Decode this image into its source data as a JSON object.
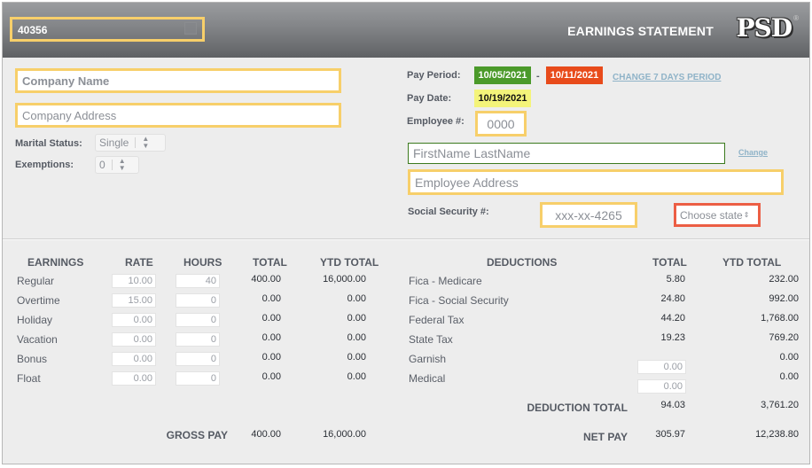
{
  "header": {
    "document_number": "40356",
    "title": "EARNINGS STATEMENT",
    "logo": "PSD",
    "logo_mark": "®"
  },
  "company": {
    "name_placeholder": "Company Name",
    "address_placeholder": "Company Address"
  },
  "employee_settings": {
    "marital_status_label": "Marital Status:",
    "marital_status_value": "Single",
    "exemptions_label": "Exemptions:",
    "exemptions_value": "0",
    "stepper_icon": "updown-arrows-icon"
  },
  "pay_info": {
    "pay_period_label": "Pay Period:",
    "pay_period_start": "10/05/2021",
    "pay_period_separator": "-",
    "pay_period_end": "10/11/2021",
    "change_period_link": "CHANGE 7 DAYS PERIOD",
    "pay_date_label": "Pay Date:",
    "pay_date": "10/19/2021",
    "employee_number_label": "Employee #:",
    "employee_number": "0000"
  },
  "employee": {
    "name_placeholder": "FirstName LastName",
    "change_link": "Change",
    "address_placeholder": "Employee Address",
    "ssn_label": "Social Security #:",
    "ssn_value": "xxx-xx-4265",
    "state_placeholder": "Choose state"
  },
  "earnings": {
    "headers": [
      "EARNINGS",
      "RATE",
      "HOURS",
      "TOTAL",
      "YTD TOTAL"
    ],
    "rows": [
      {
        "label": "Regular",
        "rate": "10.00",
        "hours": "40",
        "total": "400.00",
        "ytd": "16,000.00"
      },
      {
        "label": "Overtime",
        "rate": "15.00",
        "hours": "0",
        "total": "0.00",
        "ytd": "0.00"
      },
      {
        "label": "Holiday",
        "rate": "0.00",
        "hours": "0",
        "total": "0.00",
        "ytd": "0.00"
      },
      {
        "label": "Vacation",
        "rate": "0.00",
        "hours": "0",
        "total": "0.00",
        "ytd": "0.00"
      },
      {
        "label": "Bonus",
        "rate": "0.00",
        "hours": "0",
        "total": "0.00",
        "ytd": "0.00"
      },
      {
        "label": "Float",
        "rate": "0.00",
        "hours": "0",
        "total": "0.00",
        "ytd": "0.00"
      }
    ],
    "gross_pay_label": "GROSS PAY",
    "gross_pay_total": "400.00",
    "gross_pay_ytd": "16,000.00"
  },
  "deductions": {
    "headers": [
      "DEDUCTIONS",
      "TOTAL",
      "YTD TOTAL"
    ],
    "rows": [
      {
        "label": "Fica - Medicare",
        "total": "5.80",
        "ytd": "232.00",
        "editable": false
      },
      {
        "label": "Fica - Social Security",
        "total": "24.80",
        "ytd": "992.00",
        "editable": false
      },
      {
        "label": "Federal Tax",
        "total": "44.20",
        "ytd": "1,768.00",
        "editable": false
      },
      {
        "label": "State Tax",
        "total": "19.23",
        "ytd": "769.20",
        "editable": false
      },
      {
        "label": "Garnish",
        "total": "0.00",
        "ytd": "0.00",
        "editable": true
      },
      {
        "label": "Medical",
        "total": "0.00",
        "ytd": "0.00",
        "editable": true
      }
    ],
    "deduction_total_label": "DEDUCTION TOTAL",
    "deduction_total": "94.03",
    "deduction_total_ytd": "3,761.20",
    "net_pay_label": "NET PAY",
    "net_pay": "305.97",
    "net_pay_ytd": "12,238.80"
  },
  "colors": {
    "highlight_yellow": "#f7cf6a",
    "highlight_red": "#ec5e44",
    "highlight_green": "#3b7a1e",
    "period_start_bg": "#4b9a2a",
    "period_end_bg": "#e84b1b",
    "pay_date_bg": "#f4f47a"
  }
}
